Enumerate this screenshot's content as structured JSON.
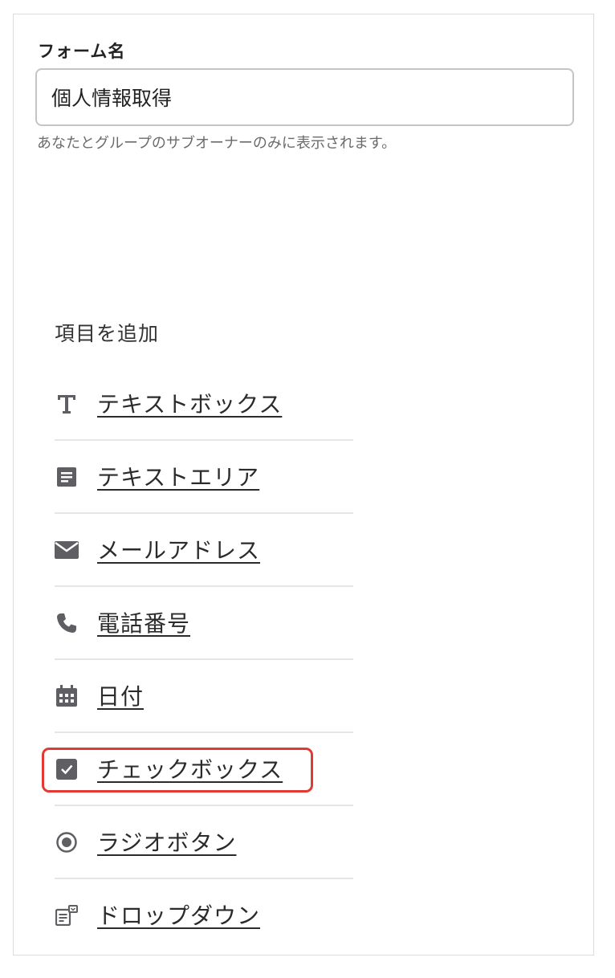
{
  "form": {
    "name_label": "フォーム名",
    "name_value": "個人情報取得",
    "help_text": "あなたとグループのサブオーナーのみに表示されます。"
  },
  "add_section": {
    "heading": "項目を追加",
    "items": [
      {
        "label": "テキストボックス",
        "icon": "text-t-icon"
      },
      {
        "label": "テキストエリア",
        "icon": "text-area-icon"
      },
      {
        "label": "メールアドレス",
        "icon": "envelope-icon"
      },
      {
        "label": "電話番号",
        "icon": "phone-icon"
      },
      {
        "label": "日付",
        "icon": "calendar-icon"
      },
      {
        "label": "チェックボックス",
        "icon": "checkbox-icon"
      },
      {
        "label": "ラジオボタン",
        "icon": "radio-icon"
      },
      {
        "label": "ドロップダウン",
        "icon": "dropdown-icon"
      }
    ]
  },
  "colors": {
    "icon": "#5f5f63",
    "highlight": "#e03a33",
    "border": "#dcdcdc"
  }
}
